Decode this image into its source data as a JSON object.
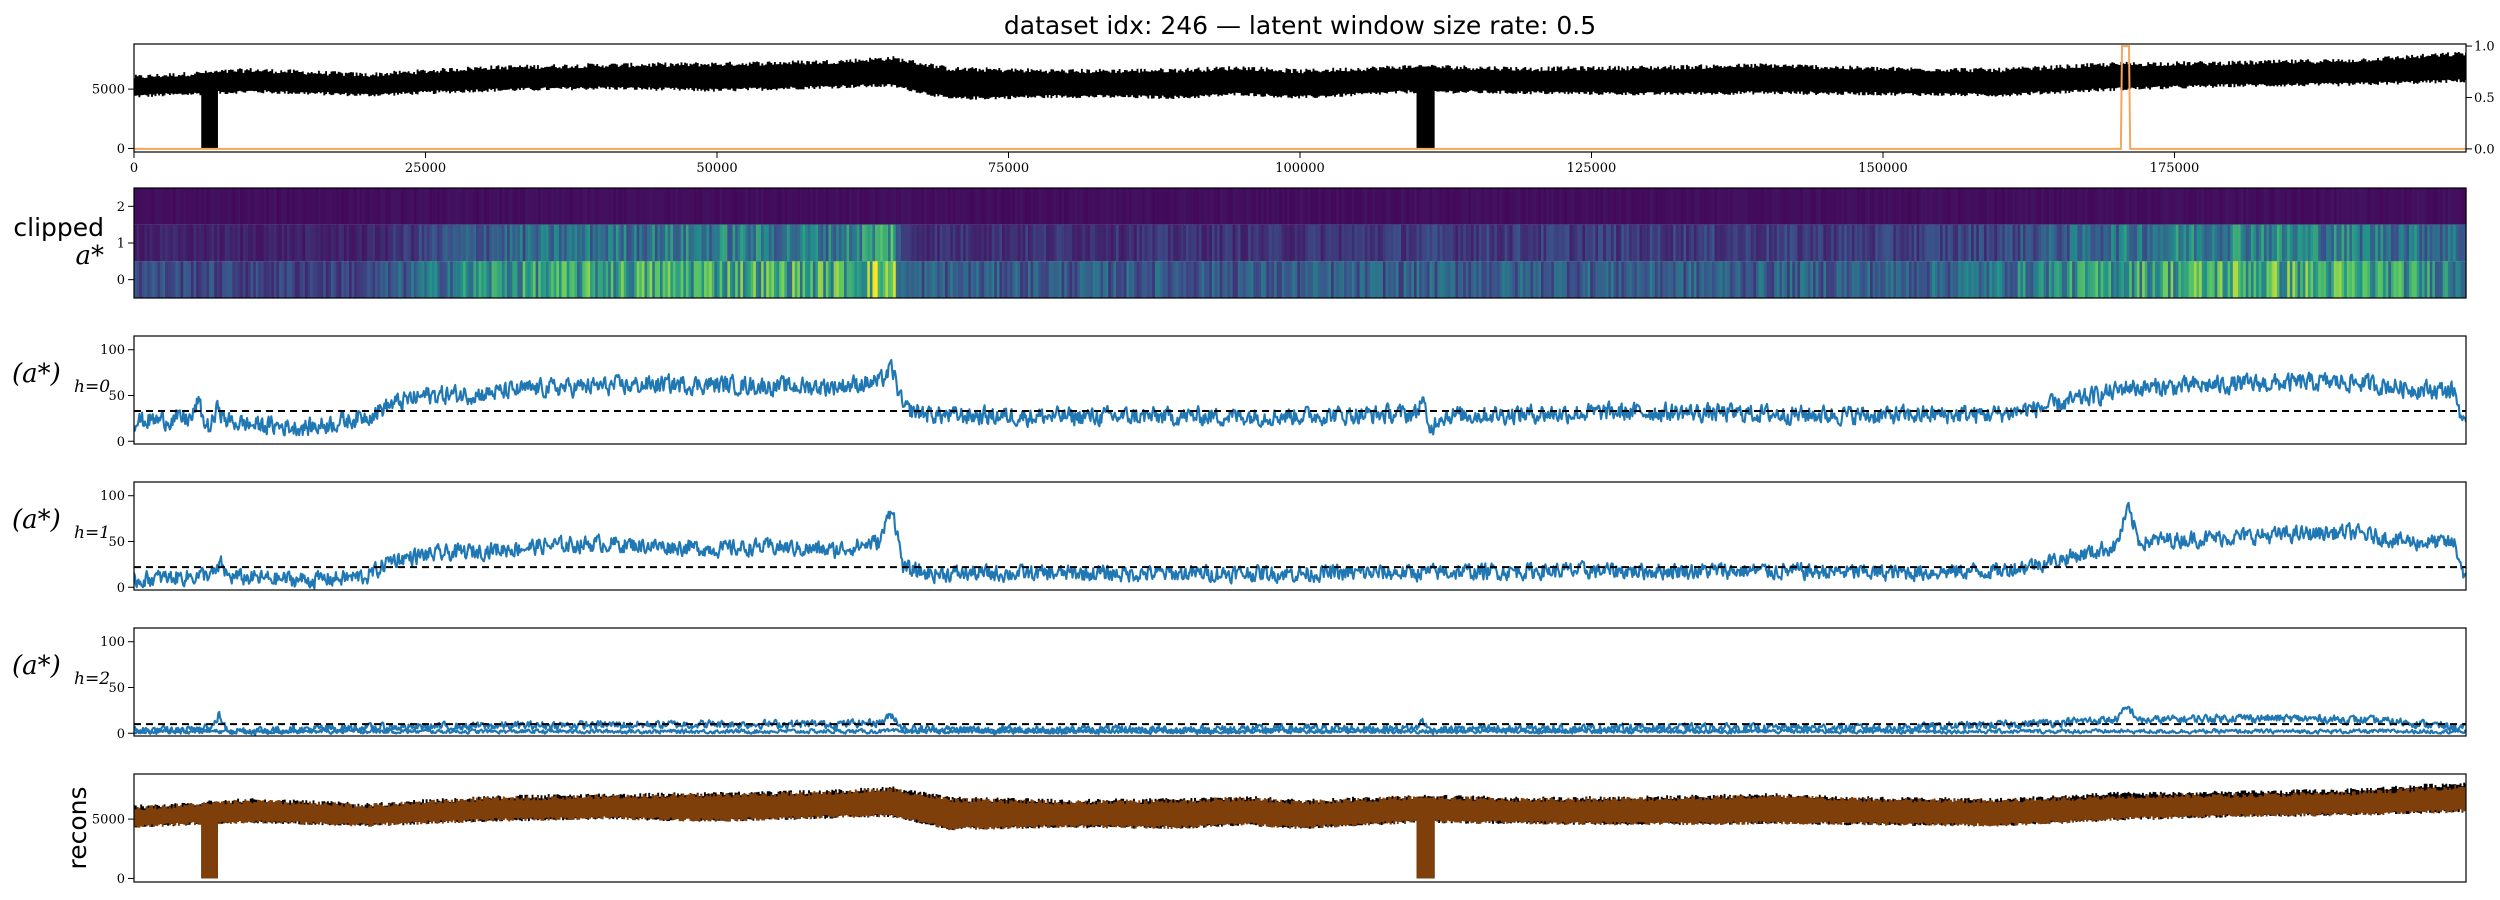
{
  "figure": {
    "title": "dataset idx: 246 — latent window size rate: 0.5"
  },
  "chart_data": [
    {
      "id": "input",
      "type": "line",
      "title": "dataset idx: 246 — latent window size rate: 0.5",
      "xlim": [
        0,
        200000
      ],
      "ylim": [
        -300,
        8800
      ],
      "yticks": [
        0,
        5000
      ],
      "xticks": [
        0,
        25000,
        50000,
        75000,
        100000,
        125000,
        150000,
        175000
      ],
      "xtick_labels": [
        "0",
        "25000",
        "50000",
        "75000",
        "100000",
        "125000",
        "150000",
        "175000"
      ],
      "y2lim": [
        -0.03,
        1.02
      ],
      "y2ticks": [
        0.0,
        0.5,
        1.0
      ],
      "y2tick_labels": [
        "0.0",
        "0.5",
        "1.0"
      ],
      "series": [
        {
          "color": "#000000",
          "band": {
            "x": [
              0,
              10000,
              20000,
              30000,
              40000,
              50000,
              60000,
              65000,
              70000,
              80000,
              90000,
              95000,
              100000,
              110000,
              120000,
              130000,
              140000,
              150000,
              160000,
              170000,
              180000,
              190000,
              200000
            ],
            "low": [
              4400,
              4800,
              4500,
              4900,
              5100,
              4900,
              5200,
              5300,
              4200,
              4400,
              4300,
              4600,
              4300,
              4800,
              4700,
              4600,
              4700,
              4600,
              4500,
              5000,
              5300,
              5400,
              5700
            ],
            "high": [
              6000,
              6600,
              6200,
              6800,
              7000,
              7100,
              7300,
              7600,
              6700,
              6500,
              6600,
              6800,
              6500,
              6900,
              6700,
              6800,
              7000,
              6700,
              6600,
              7100,
              7200,
              7400,
              8000
            ]
          },
          "drops": [
            {
              "x0": 5800,
              "x1": 7200,
              "low": 0
            },
            {
              "x0": 110000,
              "x1": 111500,
              "low": 0
            }
          ]
        },
        {
          "color": "#f5a65b",
          "axis": "right",
          "x": [
            0,
            170400,
            170500,
            171100,
            171200,
            200000
          ],
          "values": [
            0,
            0,
            1,
            1,
            0,
            0
          ]
        }
      ]
    },
    {
      "id": "clipped",
      "type": "heatmap",
      "ylabel": "clipped",
      "ylabel_math": "a*",
      "rows": [
        2,
        1,
        0
      ],
      "yticks": [
        0,
        1,
        2
      ],
      "xlim": [
        0,
        200000
      ],
      "colormap": "viridis",
      "vmin": 0,
      "vmax": 100,
      "row_profiles": [
        {
          "h": 0,
          "x": [
            0,
            10000,
            20000,
            30000,
            40000,
            50000,
            60000,
            65000,
            66000,
            80000,
            100000,
            110000,
            130000,
            150000,
            160000,
            170000,
            180000,
            190000,
            200000
          ],
          "values": [
            25,
            20,
            20,
            50,
            58,
            62,
            60,
            80,
            30,
            28,
            28,
            30,
            30,
            30,
            38,
            55,
            65,
            60,
            45
          ]
        },
        {
          "h": 1,
          "x": [
            0,
            10000,
            20000,
            30000,
            40000,
            50000,
            60000,
            65000,
            66000,
            80000,
            100000,
            110000,
            130000,
            150000,
            160000,
            170000,
            180000,
            190000,
            200000
          ],
          "values": [
            10,
            10,
            10,
            30,
            38,
            42,
            40,
            60,
            15,
            15,
            15,
            18,
            18,
            18,
            22,
            38,
            48,
            42,
            35
          ]
        },
        {
          "h": 2,
          "x": [
            0,
            200000
          ],
          "values": [
            4,
            4
          ]
        }
      ]
    },
    {
      "id": "h0",
      "type": "line",
      "ylabel_math": "(a*)",
      "ylabel_sub": "h=0",
      "ylim": [
        -3,
        115
      ],
      "yticks": [
        0,
        50,
        100
      ],
      "xlim": [
        0,
        200000
      ],
      "threshold": 33,
      "series": [
        {
          "color": "#1f77b4",
          "x": [
            0,
            5000,
            5500,
            6000,
            6500,
            7000,
            7300,
            7600,
            8000,
            10000,
            15000,
            18000,
            20000,
            22000,
            25000,
            30000,
            35000,
            40000,
            45000,
            50000,
            55000,
            60000,
            64000,
            65000,
            66000,
            68000,
            70000,
            80000,
            90000,
            100000,
            110000,
            110500,
            111000,
            112000,
            120000,
            130000,
            140000,
            150000,
            160000,
            165000,
            170000,
            171000,
            172000,
            180000,
            190000,
            195000,
            199000,
            200000
          ],
          "values": [
            22,
            25,
            45,
            20,
            15,
            28,
            42,
            25,
            22,
            18,
            15,
            22,
            28,
            40,
            50,
            52,
            58,
            60,
            62,
            62,
            60,
            60,
            65,
            80,
            35,
            30,
            28,
            27,
            27,
            28,
            30,
            50,
            10,
            28,
            30,
            32,
            30,
            28,
            30,
            40,
            55,
            60,
            58,
            62,
            65,
            58,
            55,
            10
          ],
          "noise": 9
        }
      ]
    },
    {
      "id": "h1",
      "type": "line",
      "ylabel_math": "(a*)",
      "ylabel_sub": "h=1",
      "ylim": [
        -3,
        115
      ],
      "yticks": [
        0,
        50,
        100
      ],
      "xlim": [
        0,
        200000
      ],
      "threshold": 22,
      "series": [
        {
          "color": "#1f77b4",
          "x": [
            0,
            5000,
            7000,
            7500,
            8000,
            10000,
            15000,
            18000,
            20000,
            21000,
            22000,
            25000,
            30000,
            35000,
            40000,
            45000,
            50000,
            55000,
            60000,
            64000,
            65000,
            66000,
            68000,
            70000,
            80000,
            90000,
            100000,
            110000,
            120000,
            130000,
            140000,
            150000,
            160000,
            165000,
            170000,
            171000,
            172000,
            180000,
            190000,
            195000,
            199000,
            200000
          ],
          "values": [
            8,
            12,
            15,
            25,
            12,
            10,
            8,
            10,
            12,
            20,
            30,
            35,
            40,
            45,
            48,
            45,
            42,
            44,
            40,
            50,
            90,
            20,
            15,
            15,
            15,
            15,
            15,
            16,
            18,
            18,
            18,
            16,
            18,
            30,
            45,
            85,
            50,
            55,
            60,
            50,
            48,
            8
          ],
          "noise": 8
        }
      ]
    },
    {
      "id": "h2",
      "type": "line",
      "ylabel_math": "(a*)",
      "ylabel_sub": "h=2",
      "ylim": [
        -3,
        115
      ],
      "yticks": [
        0,
        50,
        100
      ],
      "xlim": [
        0,
        200000
      ],
      "threshold": 10,
      "series": [
        {
          "color": "#1f77b4",
          "x": [
            0,
            5000,
            6000,
            6500,
            7000,
            7300,
            7600,
            8000,
            10000,
            20000,
            30000,
            40000,
            50000,
            60000,
            64000,
            65000,
            66000,
            70000,
            80000,
            90000,
            100000,
            110000,
            110500,
            111000,
            120000,
            130000,
            140000,
            150000,
            160000,
            170000,
            171000,
            172000,
            180000,
            190000,
            195000,
            200000
          ],
          "values": [
            3,
            3,
            10,
            4,
            12,
            22,
            10,
            3,
            3,
            6,
            8,
            9,
            10,
            10,
            12,
            20,
            5,
            4,
            4,
            4,
            5,
            5,
            15,
            4,
            5,
            6,
            6,
            6,
            9,
            15,
            28,
            14,
            17,
            15,
            12,
            5
          ],
          "noise": 4
        },
        {
          "color": "#1f77b4",
          "x": [
            0,
            200000
          ],
          "values": [
            2,
            2
          ],
          "noise": 2
        }
      ]
    },
    {
      "id": "recons",
      "type": "line",
      "ylabel": "recons",
      "ylim": [
        -300,
        8800
      ],
      "yticks": [
        0,
        5000
      ],
      "xlim": [
        0,
        200000
      ],
      "series": [
        {
          "color": "#000000",
          "band": {
            "x": [
              0,
              10000,
              20000,
              30000,
              40000,
              50000,
              60000,
              65000,
              70000,
              80000,
              90000,
              95000,
              100000,
              110000,
              120000,
              130000,
              140000,
              150000,
              160000,
              170000,
              180000,
              190000,
              200000
            ],
            "low": [
              4400,
              4800,
              4500,
              4900,
              5100,
              4900,
              5200,
              5300,
              4200,
              4400,
              4300,
              4600,
              4300,
              4800,
              4700,
              4600,
              4700,
              4600,
              4500,
              5000,
              5300,
              5400,
              5700
            ],
            "high": [
              6000,
              6600,
              6200,
              6800,
              7000,
              7100,
              7300,
              7600,
              6700,
              6500,
              6600,
              6800,
              6500,
              6900,
              6700,
              6800,
              7000,
              6700,
              6600,
              7100,
              7200,
              7400,
              8000
            ]
          },
          "drops": [
            {
              "x0": 5800,
              "x1": 7200,
              "low": 0
            },
            {
              "x0": 110000,
              "x1": 111500,
              "low": 0
            }
          ]
        },
        {
          "color": "#7f3f0a",
          "band": {
            "x": [
              0,
              10000,
              20000,
              30000,
              40000,
              50000,
              60000,
              65000,
              70000,
              80000,
              90000,
              95000,
              100000,
              110000,
              120000,
              130000,
              140000,
              150000,
              160000,
              170000,
              180000,
              190000,
              200000
            ],
            "low": [
              4400,
              4800,
              4500,
              4900,
              5100,
              4900,
              5200,
              5300,
              4200,
              4400,
              4300,
              4600,
              4300,
              4800,
              4700,
              4600,
              4700,
              4600,
              4500,
              5000,
              5300,
              5400,
              5700
            ],
            "high": [
              5900,
              6500,
              6100,
              6700,
              6900,
              7000,
              7200,
              7500,
              6600,
              6400,
              6500,
              6700,
              6400,
              6800,
              6600,
              6700,
              6900,
              6600,
              6500,
              6900,
              7000,
              7150,
              7750
            ]
          },
          "drops": [
            {
              "x0": 5800,
              "x1": 7200,
              "low": 0
            },
            {
              "x0": 110000,
              "x1": 111500,
              "low": 0
            }
          ]
        }
      ]
    }
  ]
}
